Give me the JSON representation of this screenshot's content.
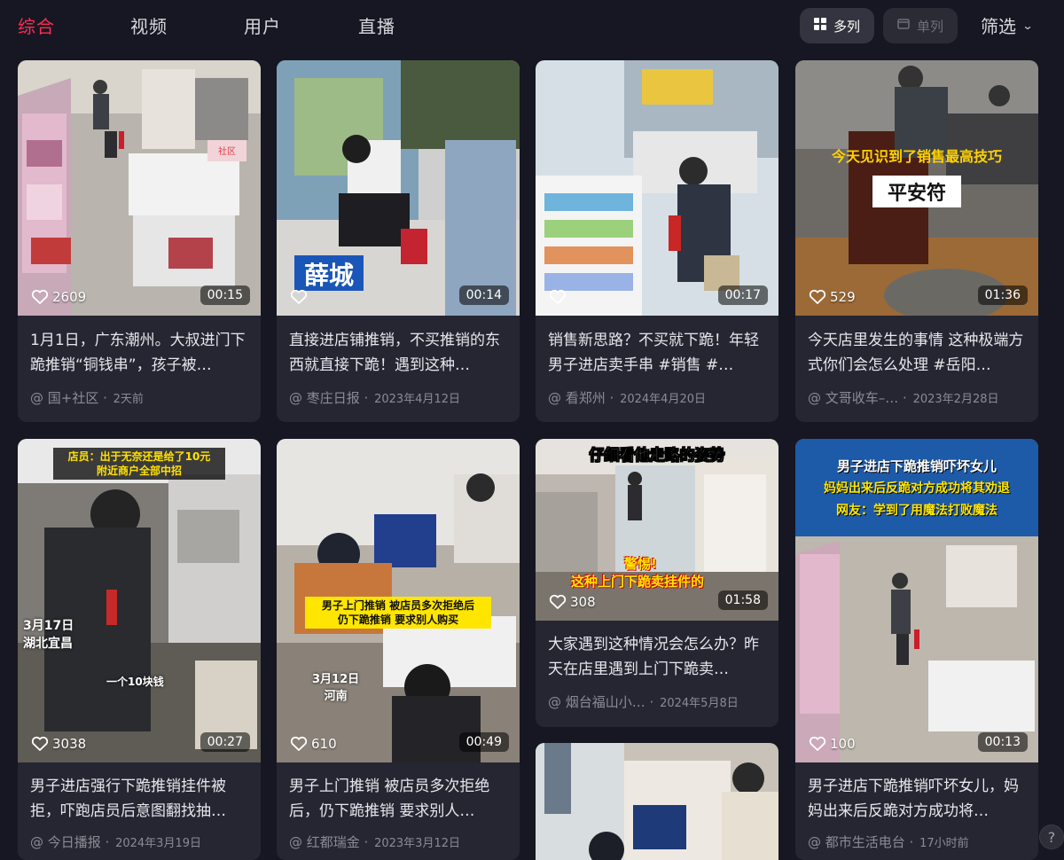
{
  "tabs": [
    "综合",
    "视频",
    "用户",
    "直播"
  ],
  "layout_toggle": {
    "multi": "多列",
    "single": "单列"
  },
  "filter": {
    "label": "筛选"
  },
  "cards": [
    {
      "likes": "2609",
      "duration": "00:15",
      "title": "1月1日，广东潮州。大叔进门下跪推销“铜钱串”，孩子被…",
      "author": "@ 国+社区",
      "date": "2天前"
    },
    {
      "likes": "",
      "duration": "00:14",
      "title": "直接进店铺推销，不买推销的东西就直接下跪！遇到这种…",
      "author": "@ 枣庄日报",
      "date": "2023年4月12日",
      "overlay": "薛城"
    },
    {
      "likes": "",
      "duration": "00:17",
      "title": "销售新思路？不买就下跪！年轻男子进店卖手串 #销售 #…",
      "author": "@ 看郑州",
      "date": "2024年4月20日"
    },
    {
      "likes": "529",
      "duration": "01:36",
      "title": "今天店里发生的事情 这种极端方式你们会怎么处理 #岳阳…",
      "author": "@ 文哥收车–…",
      "date": "2023年2月28日",
      "overlay1": "今天见识到了销售最高技巧",
      "overlay2": "平安符"
    },
    {
      "likes": "3038",
      "duration": "00:27",
      "title": "男子进店强行下跪推销挂件被拒，吓跑店员后意图翻找抽…",
      "author": "@ 今日播报",
      "date": "2024年3月19日",
      "overlay1": "店员：出于无奈还是给了10元",
      "overlay2": "附近商户全部中招",
      "overlay3": "3月17日",
      "overlay4": "湖北宜昌",
      "overlay5": "一个10块钱"
    },
    {
      "likes": "610",
      "duration": "00:49",
      "title": "男子上门推销 被店员多次拒绝后，仍下跪推销 要求别人…",
      "author": "@ 红都瑞金",
      "date": "2023年3月12日",
      "overlay1": "男子上门推销 被店员多次拒绝后",
      "overlay2": "仍下跪推销 要求别人购买",
      "overlay3": "3月12日",
      "overlay4": "河南"
    },
    {
      "likes": "308",
      "duration": "01:58",
      "title": "大家遇到这种情况会怎么办？昨天在店里遇到上门下跪卖…",
      "author": "@ 烟台福山小…",
      "date": "2024年5月8日",
      "overlay1": "仔细看他走路的姿势",
      "overlay2": "警惕!",
      "overlay3": "这种上门下跪卖挂件的"
    },
    {
      "likes": "",
      "duration": "",
      "title": "",
      "author": "",
      "date": ""
    },
    {
      "likes": "100",
      "duration": "00:13",
      "title": "男子进店下跪推销吓坏女儿，妈妈出来后反跪对方成功将…",
      "author": "@ 都市生活电台",
      "date": "17小时前",
      "overlay1": "男子进店下跪推销吓坏女儿",
      "overlay2": "妈妈出来后反跪对方成功将其劝退",
      "overlay3": "网友：学到了用魔法打败魔法"
    }
  ],
  "help": "?"
}
